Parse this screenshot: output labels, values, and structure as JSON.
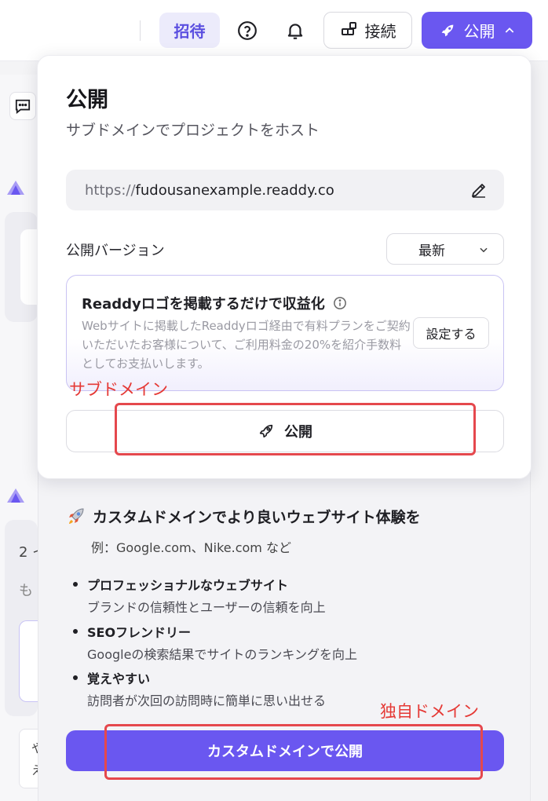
{
  "topbar": {
    "invite_label": "招待",
    "connect_label": "接続",
    "publish_label": "公開",
    "icons": [
      "help-icon",
      "bell-icon",
      "connect-icon",
      "rocket-icon",
      "chevron-up-icon"
    ]
  },
  "background": {
    "snippet_1": "2 イ",
    "snippet_2": "も",
    "snippet_3": "や",
    "snippet_4": "え"
  },
  "popover": {
    "title": "公開",
    "subtitle": "サブドメインでプロジェクトをホスト",
    "url_prefix": "https://",
    "url_domain": "fudousanexample.readdy.co",
    "version_label": "公開バージョン",
    "version_value": "最新",
    "monetize_title": "Readdyロゴを掲載するだけで収益化",
    "monetize_desc": "Webサイトに掲載したReaddyロゴ経由で有料プランをご契約いただいたお客様について、ご利用料金の20%を紹介手数料としてお支払いします。",
    "settings_label": "設定する",
    "publish_label": "公開"
  },
  "custom_domain": {
    "heading": "カスタムドメインでより良いウェブサイト体験を",
    "example": "例：Google.com、Nike.com など",
    "features": [
      {
        "title": "プロフェッショナルなウェブサイト",
        "desc": "ブランドの信頼性とユーザーの信頼を向上"
      },
      {
        "title": "SEOフレンドリー",
        "desc": "Googleの検索結果でサイトのランキングを向上"
      },
      {
        "title": "覚えやすい",
        "desc": "訪問者が次回の訪問時に簡単に思い出せる"
      }
    ],
    "publish_label": "カスタムドメインで公開"
  },
  "annotations": {
    "subdomain_label": "サブドメイン",
    "custom_label": "独自ドメイン"
  },
  "colors": {
    "accent": "#6a57f0",
    "annotation": "#e5484d"
  }
}
